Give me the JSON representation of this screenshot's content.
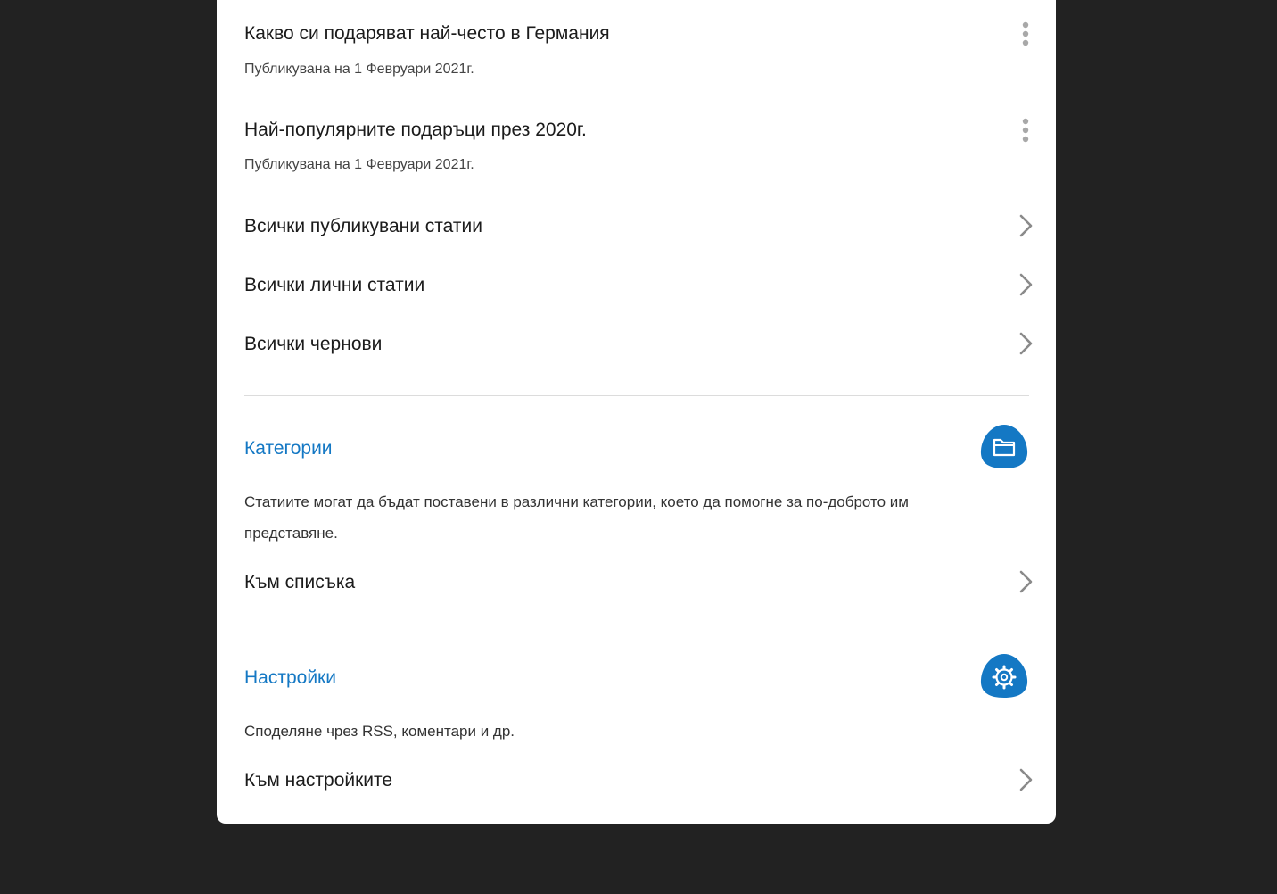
{
  "articles": [
    {
      "title": "Какво си подаряват най-често в Германия",
      "meta": "Публикувана на 1 Февруари 2021г."
    },
    {
      "title": "Най-популярните подаръци през 2020г.",
      "meta": "Публикувана на 1 Февруари 2021г."
    }
  ],
  "links": {
    "published": "Всички публикувани статии",
    "personal": "Всички лични статии",
    "drafts": "Всички чернови"
  },
  "categories": {
    "title": "Категории",
    "description": "Статиите могат да бъдат поставени в различни категории, което да помогне за по-доброто им представяне.",
    "link": "Към списъка",
    "icon": "folder-icon"
  },
  "settings": {
    "title": "Настройки",
    "description": "Споделяне чрез RSS, коментари и др.",
    "link": "Към настройките",
    "icon": "gear-icon"
  },
  "colors": {
    "background": "#222222",
    "panel": "#ffffff",
    "accent": "#1478c4",
    "chevron": "#8a8a8a"
  }
}
